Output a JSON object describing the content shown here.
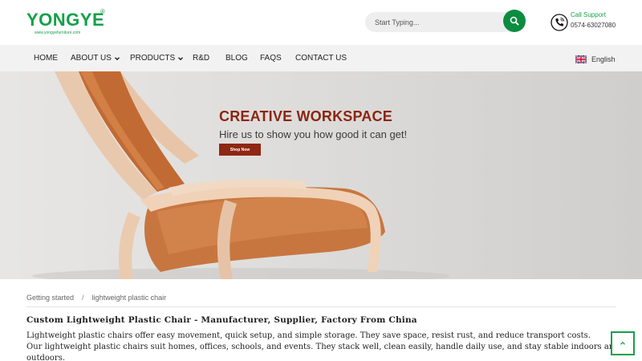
{
  "header": {
    "logo_text": "YONGYE",
    "logo_mark": "®",
    "logo_url": "www.yongyefurniture.com",
    "search_placeholder": "Start Typing...",
    "search_icon": "search-icon",
    "support_label": "Call Support",
    "support_phone": "0574-63027080",
    "support_icon": "phone-icon"
  },
  "nav": {
    "items": [
      {
        "label": "HOME",
        "has_dropdown": false
      },
      {
        "label": "ABOUT US",
        "has_dropdown": true
      },
      {
        "label": "PRODUCTS",
        "has_dropdown": true
      },
      {
        "label": "R&D",
        "has_dropdown": false
      },
      {
        "label": "BLOG",
        "has_dropdown": false
      },
      {
        "label": "FAQS",
        "has_dropdown": false
      },
      {
        "label": "CONTACT US",
        "has_dropdown": false
      }
    ],
    "language": "English",
    "language_icon": "uk-flag-icon"
  },
  "hero": {
    "title": "CREATIVE WORKSPACE",
    "subtitle": "Hire us to show you how good it can get!",
    "button": "Shop Now"
  },
  "breadcrumb": {
    "items": [
      "Getting started",
      "lightweight plastic chair"
    ],
    "separator": "/"
  },
  "content": {
    "title": "Custom Lightweight Plastic Chair - Manufacturer, Supplier, Factory From China",
    "para1": "Lightweight plastic chairs offer easy movement, quick setup, and simple storage. They save space, resist rust, and reduce transport costs.",
    "para2": "Our lightweight plastic chairs suit homes, offices, schools, and events. They stack well, clean easily, handle daily use, and stay stable indoors and outdoors."
  },
  "colors": {
    "brand_green": "#15a04a",
    "search_button": "#0c8c3f",
    "hero_accent": "#8e2713"
  },
  "back_to_top_icon": "chevron-up-icon"
}
